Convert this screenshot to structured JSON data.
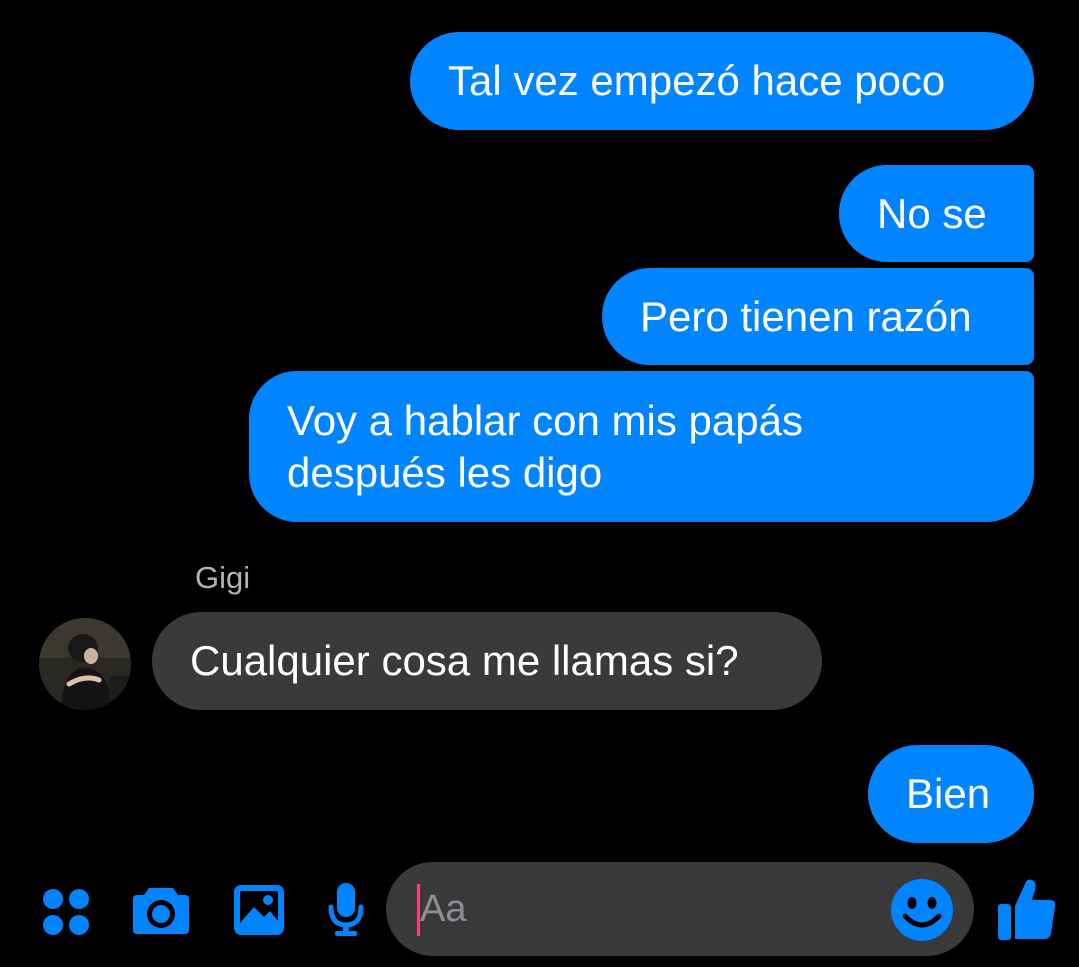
{
  "messages": [
    {
      "direction": "outgoing",
      "text": "Tal vez empezó hace poco"
    },
    {
      "direction": "outgoing",
      "text": "No se"
    },
    {
      "direction": "outgoing",
      "text": "Pero tienen razón"
    },
    {
      "direction": "outgoing",
      "lines": [
        "Voy a hablar con mis papás",
        "después les digo"
      ]
    },
    {
      "direction": "incoming",
      "sender": "Gigi",
      "text": "Cualquier cosa me llamas si?"
    },
    {
      "direction": "outgoing",
      "text": "Bien"
    }
  ],
  "composer": {
    "placeholder": "Aa"
  },
  "toolbar_icons": [
    "apps-icon",
    "camera-icon",
    "gallery-icon",
    "microphone-icon",
    "emoji-icon",
    "thumbs-up-icon"
  ],
  "colors": {
    "background": "#000000",
    "outgoing_bubble": "#0084ff",
    "incoming_bubble": "#3a3a3c",
    "accent": "#0084ff",
    "cursor": "#ff3b7f"
  }
}
